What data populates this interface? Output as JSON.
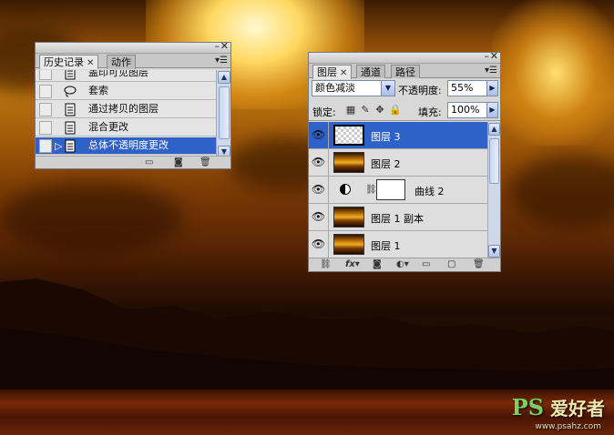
{
  "history_panel": {
    "tabs": [
      {
        "label": "历史记录",
        "active": true
      },
      {
        "label": "动作",
        "active": false
      }
    ],
    "items": [
      {
        "label": "盖印可见图层",
        "icon": "document-icon",
        "selected": false
      },
      {
        "label": "套索",
        "icon": "lasso-icon",
        "selected": false
      },
      {
        "label": "通过拷贝的图层",
        "icon": "document-icon",
        "selected": false
      },
      {
        "label": "混合更改",
        "icon": "document-icon",
        "selected": false
      },
      {
        "label": "总体不透明度更改",
        "icon": "document-icon",
        "selected": true
      }
    ],
    "bottom_icons": [
      "new-document-icon",
      "camera-icon",
      "trash-icon"
    ]
  },
  "layers_panel": {
    "tabs": [
      {
        "label": "图层",
        "active": true
      },
      {
        "label": "通道",
        "active": false
      },
      {
        "label": "路径",
        "active": false
      }
    ],
    "blend_mode": "颜色减淡",
    "opacity_label": "不透明度:",
    "opacity_value": "55%",
    "lock_label": "锁定:",
    "fill_label": "填充:",
    "fill_value": "100%",
    "layers": [
      {
        "name": "图层 3",
        "thumb": "transparent",
        "visible": true,
        "selected": true
      },
      {
        "name": "图层 2",
        "thumb": "sunset",
        "visible": true,
        "selected": false
      },
      {
        "name": "曲线 2",
        "thumb": "adjustment",
        "visible": true,
        "selected": false
      },
      {
        "name": "图层 1 副本",
        "thumb": "sunset",
        "visible": true,
        "selected": false
      },
      {
        "name": "图层 1",
        "thumb": "sunset",
        "visible": true,
        "selected": false
      }
    ],
    "bottom_icons": [
      "link-icon",
      "fx-icon",
      "mask-icon",
      "adjustment-icon",
      "folder-icon",
      "new-layer-icon",
      "trash-icon"
    ]
  },
  "watermark": {
    "brand": "PS",
    "text": "爱好者",
    "url": "www.psahz.com"
  }
}
